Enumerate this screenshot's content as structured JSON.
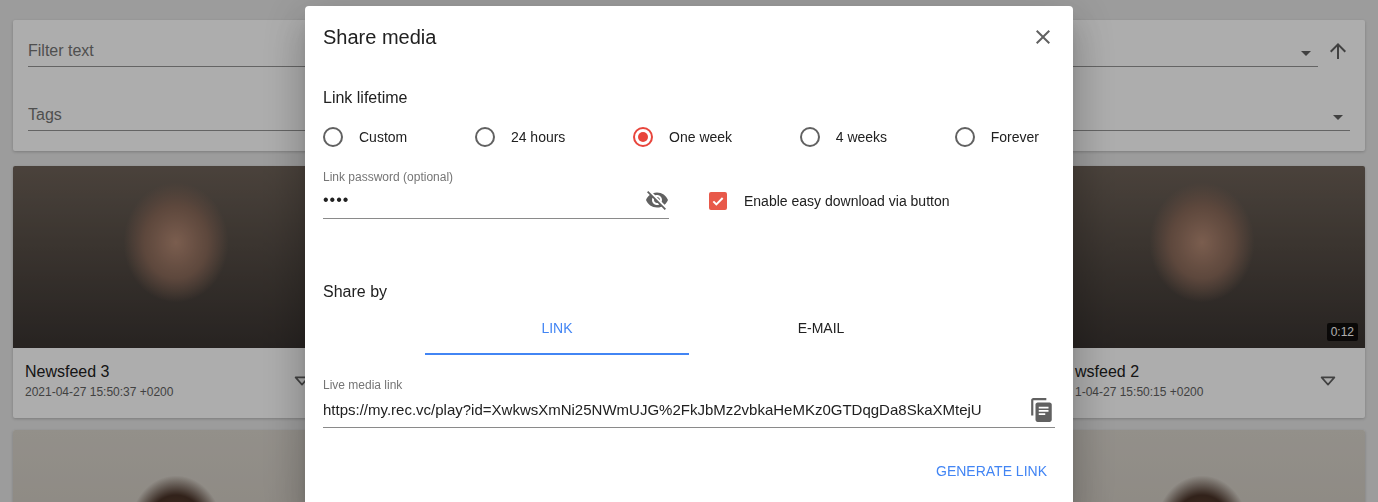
{
  "background": {
    "filters": {
      "text_placeholder": "Filter text",
      "tags_placeholder": "Tags"
    },
    "media": [
      {
        "title": "Newsfeed 3",
        "date": "2021-04-27 15:50:37 +0200"
      },
      {
        "title": "wsfeed 2",
        "date": "1-04-27 15:50:15 +0200",
        "duration": "0:12"
      }
    ]
  },
  "dialog": {
    "title": "Share media",
    "lifetime": {
      "label": "Link lifetime",
      "options": [
        {
          "label": "Custom",
          "selected": false
        },
        {
          "label": "24 hours",
          "selected": false
        },
        {
          "label": "One week",
          "selected": true
        },
        {
          "label": "4 weeks",
          "selected": false
        },
        {
          "label": "Forever",
          "selected": false
        }
      ]
    },
    "password": {
      "label": "Link password (optional)",
      "value": "••••"
    },
    "easy_download": {
      "label": "Enable easy download via button",
      "checked": true
    },
    "share_by": {
      "label": "Share by",
      "tabs": [
        {
          "label": "LINK",
          "selected": true
        },
        {
          "label": "E-MAIL",
          "selected": false
        }
      ]
    },
    "link_field": {
      "label": "Live media link",
      "value": "https://my.rec.vc/play?id=XwkwsXmNi25NWmUJG%2FkJbMz2vbkaHeMKz0GTDqgDa8SkaXMtejU"
    },
    "buttons": [
      "GENERATE LINK"
    ]
  }
}
